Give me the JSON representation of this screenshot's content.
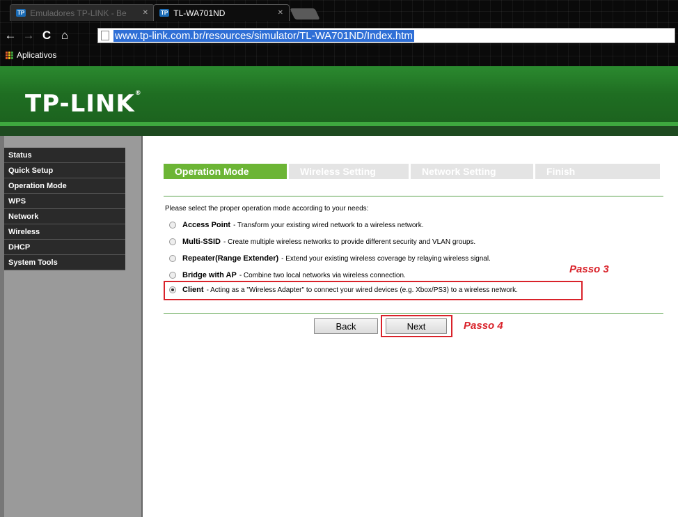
{
  "browser": {
    "tabs": [
      {
        "title": "Emuladores TP-LINK - Be",
        "favicon": "TP",
        "close": "✕"
      },
      {
        "title": "TL-WA701ND",
        "favicon": "TP",
        "close": "✕"
      }
    ],
    "url": "www.tp-link.com.br/resources/simulator/TL-WA701ND/Index.htm",
    "bookmarks": {
      "apps_label": "Aplicativos"
    }
  },
  "header": {
    "logo": "TP-LINK",
    "logo_mark": "®"
  },
  "sidebar": {
    "items": [
      {
        "label": "Status"
      },
      {
        "label": "Quick Setup"
      },
      {
        "label": "Operation Mode"
      },
      {
        "label": "WPS"
      },
      {
        "label": "Network"
      },
      {
        "label": "Wireless"
      },
      {
        "label": "DHCP"
      },
      {
        "label": "System Tools"
      }
    ]
  },
  "wizard": {
    "steps": [
      {
        "label": "Operation Mode",
        "active": true
      },
      {
        "label": "Wireless Setting",
        "active": false
      },
      {
        "label": "Network Setting",
        "active": false
      },
      {
        "label": "Finish",
        "active": false
      }
    ],
    "intro": "Please select the proper operation mode according to your needs:",
    "options": [
      {
        "name": "Access Point",
        "desc": "- Transform your existing wired network to a wireless network.",
        "selected": false
      },
      {
        "name": "Multi-SSID",
        "desc": "- Create multiple wireless networks to provide different security and VLAN groups.",
        "selected": false
      },
      {
        "name": "Repeater(Range Extender)",
        "desc": "- Extend your existing wireless coverage by relaying wireless signal.",
        "selected": false
      },
      {
        "name": "Bridge with AP",
        "desc": "- Combine two local networks via wireless connection.",
        "selected": false
      },
      {
        "name": "Client",
        "desc": "- Acting as a \"Wireless Adapter\" to connect your wired devices (e.g. Xbox/PS3) to a wireless network.",
        "selected": true
      }
    ],
    "back_label": "Back",
    "next_label": "Next"
  },
  "annotations": {
    "step3": "Passo 3",
    "step4": "Passo 4",
    "color": "#d9222a"
  },
  "colors": {
    "brand_green": "#1f6e22",
    "active_step": "#6cb535",
    "menu_bg": "#2a2a2a"
  }
}
